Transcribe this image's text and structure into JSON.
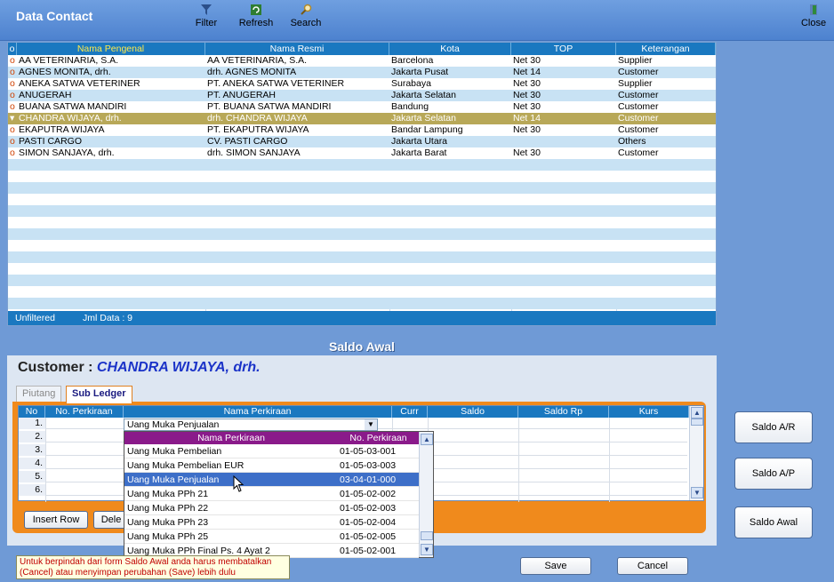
{
  "app": {
    "title": "Data Contact"
  },
  "toolbar": {
    "filter": "Filter",
    "refresh": "Refresh",
    "search": "Search",
    "close": "Close"
  },
  "grid": {
    "marker_header": "o",
    "columns": [
      "Nama Pengenal",
      "Nama Resmi",
      "Kota",
      "TOP",
      "Keterangan"
    ],
    "rows": [
      {
        "marker": "o",
        "pengenal": "AA VETERINARIA, S.A.",
        "resmi": "AA VETERINARIA, S.A.",
        "kota": "Barcelona",
        "top": "Net 30",
        "ket": "Supplier"
      },
      {
        "marker": "o",
        "pengenal": "AGNES MONITA, drh.",
        "resmi": "drh. AGNES MONITA",
        "kota": "Jakarta Pusat",
        "top": "Net 14",
        "ket": "Customer"
      },
      {
        "marker": "o",
        "pengenal": "ANEKA SATWA VETERINER",
        "resmi": "PT. ANEKA SATWA VETERINER",
        "kota": "Surabaya",
        "top": "Net 30",
        "ket": "Supplier"
      },
      {
        "marker": "o",
        "pengenal": "ANUGERAH",
        "resmi": "PT. ANUGERAH",
        "kota": "Jakarta Selatan",
        "top": "Net 30",
        "ket": "Customer"
      },
      {
        "marker": "o",
        "pengenal": "BUANA SATWA MANDIRI",
        "resmi": "PT. BUANA SATWA MANDIRI",
        "kota": "Bandung",
        "top": "Net 30",
        "ket": "Customer"
      },
      {
        "marker": "▾",
        "pengenal": "CHANDRA WIJAYA, drh.",
        "resmi": "drh. CHANDRA WIJAYA",
        "kota": "Jakarta Selatan",
        "top": "Net 14",
        "ket": "Customer"
      },
      {
        "marker": "o",
        "pengenal": "EKAPUTRA WIJAYA",
        "resmi": "PT. EKAPUTRA WIJAYA",
        "kota": "Bandar Lampung",
        "top": "Net 30",
        "ket": "Customer"
      },
      {
        "marker": "o",
        "pengenal": "PASTI CARGO",
        "resmi": "CV. PASTI CARGO",
        "kota": "Jakarta Utara",
        "top": "",
        "ket": "Others"
      },
      {
        "marker": "o",
        "pengenal": "SIMON SANJAYA, drh.",
        "resmi": "drh. SIMON SANJAYA",
        "kota": "Jakarta Barat",
        "top": "Net 30",
        "ket": "Customer"
      }
    ],
    "selected_index": 5,
    "footer_status": "Unfiltered",
    "footer_count": "Jml Data : 9"
  },
  "saldo": {
    "title": "Saldo Awal",
    "customer_label": "Customer :",
    "customer_name": "CHANDRA WIJAYA, drh.",
    "tabs": [
      "Piutang",
      "Sub Ledger"
    ],
    "active_tab": "Sub Ledger",
    "columns": [
      "No",
      "No. Perkiraan",
      "Nama Perkiraan",
      "Curr",
      "Saldo",
      "Saldo Rp",
      "Kurs"
    ],
    "row_numbers": [
      "1.",
      "2.",
      "3.",
      "4.",
      "5.",
      "6."
    ],
    "combo_value": "Uang Muka Penjualan",
    "dropdown": {
      "columns": [
        "Nama Perkiraan",
        "No. Perkiraan"
      ],
      "items": [
        {
          "name": "Uang Muka Pembelian",
          "code": "01-05-03-001"
        },
        {
          "name": "Uang Muka Pembelian EUR",
          "code": "01-05-03-003"
        },
        {
          "name": "Uang Muka Penjualan",
          "code": "03-04-01-000"
        },
        {
          "name": "Uang Muka PPh 21",
          "code": "01-05-02-002"
        },
        {
          "name": "Uang Muka PPh 22",
          "code": "01-05-02-003"
        },
        {
          "name": "Uang Muka PPh 23",
          "code": "01-05-02-004"
        },
        {
          "name": "Uang Muka PPh 25",
          "code": "01-05-02-005"
        },
        {
          "name": "Uang Muka PPh Final Ps. 4 Ayat 2",
          "code": "01-05-02-001"
        }
      ],
      "selected_index": 2
    },
    "insert_row": "Insert Row",
    "delete_row": "Dele",
    "save": "Save",
    "cancel": "Cancel",
    "notice": "Untuk berpindah dari form Saldo Awal anda harus membatalkan (Cancel) atau menyimpan perubahan (Save) lebih dulu"
  },
  "side_buttons": {
    "ar": "Saldo A/R",
    "ap": "Saldo A/P",
    "awal": "Saldo Awal"
  }
}
